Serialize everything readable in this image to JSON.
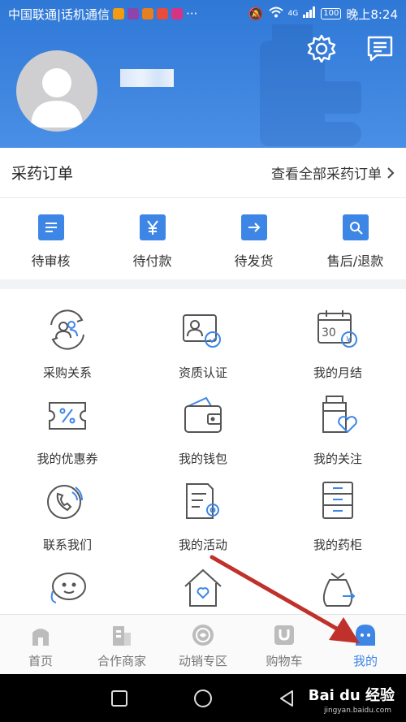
{
  "status_bar": {
    "carrier": "中国联通|话机通信",
    "network": "4G",
    "battery": "100",
    "time": "晚上8:24"
  },
  "header": {
    "settings_icon": "gear-icon",
    "message_icon": "message-icon",
    "colors": {
      "gradient_top": "#2f78d6",
      "gradient_bottom": "#4a8fe6"
    }
  },
  "orders": {
    "title": "采药订单",
    "view_all": "查看全部采药订单",
    "items": [
      {
        "label": "待审核",
        "icon": "review-icon"
      },
      {
        "label": "待付款",
        "icon": "yen-icon"
      },
      {
        "label": "待发货",
        "icon": "ship-arrow-icon"
      },
      {
        "label": "售后/退款",
        "icon": "wrench-icon"
      }
    ]
  },
  "features": [
    {
      "label": "采购关系",
      "icon": "relation-icon"
    },
    {
      "label": "资质认证",
      "icon": "certificate-icon"
    },
    {
      "label": "我的月结",
      "icon": "calendar-icon"
    },
    {
      "label": "我的优惠券",
      "icon": "coupon-icon"
    },
    {
      "label": "我的钱包",
      "icon": "wallet-icon"
    },
    {
      "label": "我的关注",
      "icon": "follow-icon"
    },
    {
      "label": "联系我们",
      "icon": "phone-icon"
    },
    {
      "label": "我的活动",
      "icon": "activity-icon"
    },
    {
      "label": "我的药柜",
      "icon": "cabinet-icon"
    }
  ],
  "calendar_day": "30",
  "tabs": [
    {
      "label": "首页",
      "icon": "home-icon"
    },
    {
      "label": "合作商家",
      "icon": "merchant-icon"
    },
    {
      "label": "动销专区",
      "icon": "promo-icon"
    },
    {
      "label": "购物车",
      "icon": "cart-icon"
    },
    {
      "label": "我的",
      "icon": "profile-icon",
      "active": true
    }
  ],
  "accent_color": "#3d86e6",
  "watermark": "Bai du 经验",
  "watermark_sub": "jingyan.baidu.com"
}
